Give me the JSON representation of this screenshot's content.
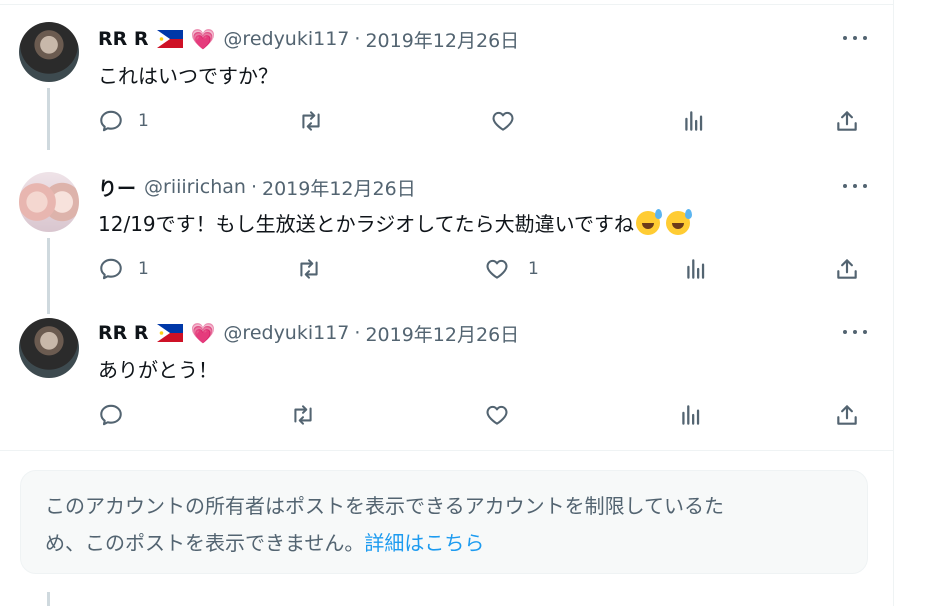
{
  "tweets": [
    {
      "name": "RR R",
      "flag": "philippines-flag",
      "badge": "💗",
      "handle": "@redyuki117",
      "sep": "·",
      "date": "2019年12月26日",
      "text": "これはいつですか？",
      "reply_count": "1",
      "like_count": ""
    },
    {
      "name": "りー",
      "handle": "@riiirichan",
      "sep": "·",
      "date": "2019年12月26日",
      "text": "12/19です！もし生放送とかラジオしてたら大勘違いですね",
      "reply_count": "1",
      "like_count": "1"
    },
    {
      "name": "RR R",
      "flag": "philippines-flag",
      "badge": "💗",
      "handle": "@redyuki117",
      "sep": "·",
      "date": "2019年12月26日",
      "text": "ありがとう！",
      "reply_count": "",
      "like_count": ""
    }
  ],
  "notice": {
    "line1": "このアカウントの所有者はポストを表示できるアカウントを制限しているた",
    "line2": "め、このポストを表示できません。",
    "link": "詳細はこちら"
  },
  "colors": {
    "text": "#0f1419",
    "secondary": "#536471",
    "link": "#1d9bf0",
    "thread_line": "#cfd9de"
  }
}
